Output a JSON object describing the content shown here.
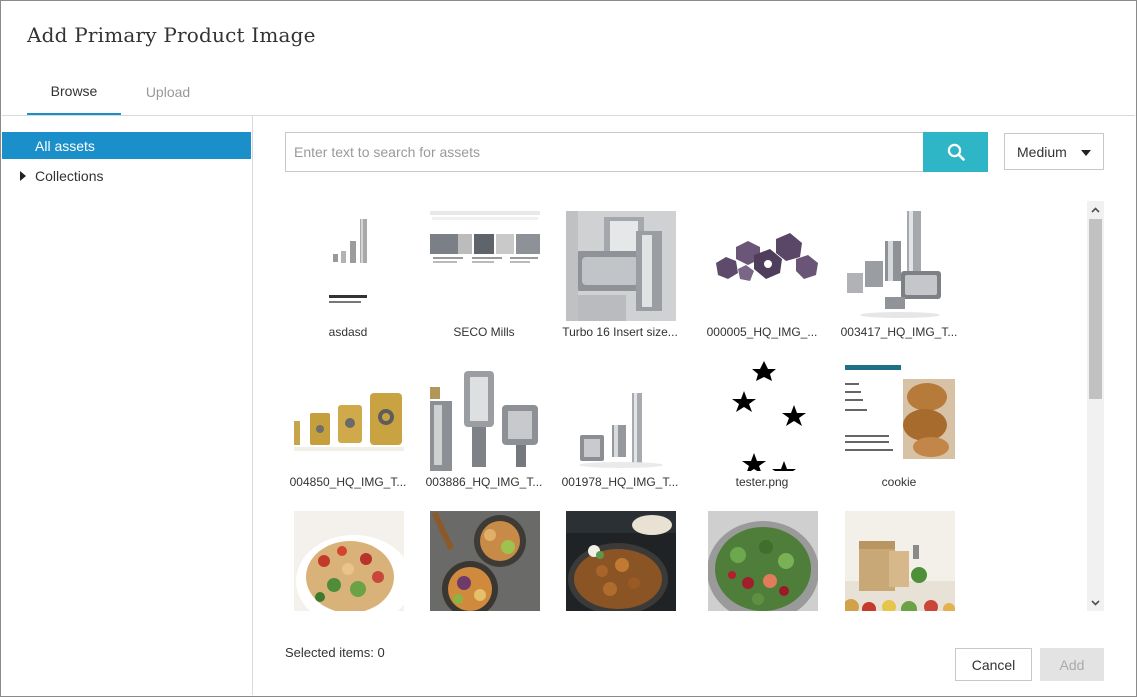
{
  "dialog": {
    "title": "Add Primary Product Image"
  },
  "tabs": [
    {
      "label": "Browse",
      "active": true
    },
    {
      "label": "Upload",
      "active": false
    }
  ],
  "sidebar": {
    "items": [
      {
        "label": "All assets",
        "selected": true
      },
      {
        "label": "Collections",
        "selected": false,
        "expandable": true
      }
    ]
  },
  "search": {
    "placeholder": "Enter text to search for assets",
    "value": ""
  },
  "size_select": {
    "value": "Medium"
  },
  "assets": [
    {
      "label": "asdasd",
      "thumb": "installation-manual"
    },
    {
      "label": "SECO Mills",
      "thumb": "webpage-screenshot"
    },
    {
      "label": "Turbo 16 Insert size...",
      "thumb": "mill-closeup"
    },
    {
      "label": "000005_HQ_IMG_...",
      "thumb": "purple-inserts"
    },
    {
      "label": "003417_HQ_IMG_T...",
      "thumb": "mill-cutters"
    },
    {
      "label": "004850_HQ_IMG_T...",
      "thumb": "gold-inserts"
    },
    {
      "label": "003886_HQ_IMG_T...",
      "thumb": "mill-heads"
    },
    {
      "label": "001978_HQ_IMG_T...",
      "thumb": "end-mill-long"
    },
    {
      "label": "tester.png",
      "thumb": "stars"
    },
    {
      "label": "cookie",
      "thumb": "cookie-recipe"
    },
    {
      "label": "",
      "thumb": "salad-bowl"
    },
    {
      "label": "",
      "thumb": "buddha-bowls"
    },
    {
      "label": "",
      "thumb": "curry-pan"
    },
    {
      "label": "",
      "thumb": "green-salad"
    },
    {
      "label": "",
      "thumb": "grocery-box"
    }
  ],
  "footer": {
    "selected_text": "Selected items: 0",
    "cancel_label": "Cancel",
    "add_label": "Add"
  },
  "colors": {
    "accent": "#1a8fc9",
    "search_button": "#2fb6c6"
  },
  "icons": {
    "search": "search-icon",
    "dropdown": "caret-down-icon",
    "tree": "expand-triangle-icon"
  }
}
